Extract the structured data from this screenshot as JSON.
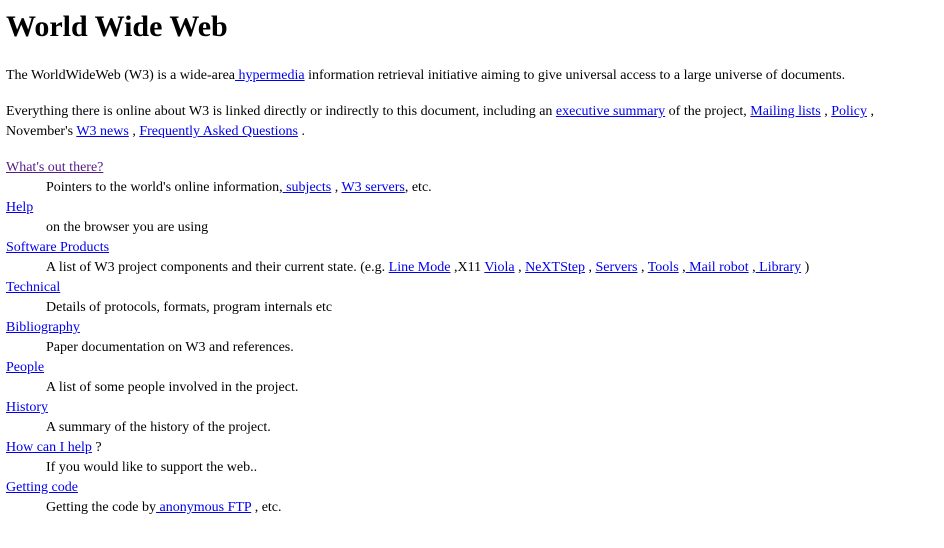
{
  "page_title": "World Wide Web",
  "intro": {
    "before": "The WorldWideWeb (W3) is a wide-area",
    "link_hypermedia": " hypermedia",
    "after": " information retrieval initiative aiming to give universal access to a large universe of documents."
  },
  "everything": {
    "t1": "Everything there is online about W3 is linked directly or indirectly to this document, including an ",
    "link_exec": "executive summary",
    "t2": " of the project, ",
    "link_mailing": "Mailing lists",
    "t3": " , ",
    "link_policy": "Policy",
    "t4": " , November's ",
    "link_news": "W3 news",
    "t5": " , ",
    "link_faq": "Frequently Asked Questions",
    "t6": " ."
  },
  "sections": {
    "whats_out": {
      "link": "What's out there?",
      "d1": "Pointers to the world's online information,",
      "link_subjects": " subjects",
      "d2": " , ",
      "link_servers": "W3 servers",
      "d3": ", etc."
    },
    "help": {
      "link": "Help",
      "desc": "on the browser you are using"
    },
    "software": {
      "link": "Software Products",
      "d1": "A list of W3 project components and their current state. (e.g. ",
      "link_linemode": "Line Mode",
      "d2": " ,X11 ",
      "link_viola": "Viola",
      "d3": " , ",
      "link_nextstep": "NeXTStep",
      "d4": " , ",
      "link_servers": "Servers",
      "d5": " , ",
      "link_tools": "Tools",
      "d6": " ,",
      "link_mailrobot": " Mail robot",
      "d7": " ,",
      "link_library": " Library",
      "d8": " )"
    },
    "technical": {
      "link": "Technical",
      "desc": "Details of protocols, formats, program internals etc"
    },
    "bibliography": {
      "link": "Bibliography",
      "desc": "Paper documentation on W3 and references."
    },
    "people": {
      "link": "People",
      "desc": "A list of some people involved in the project."
    },
    "history": {
      "link": "History",
      "desc": "A summary of the history of the project."
    },
    "how_help": {
      "link": "How can I help",
      "after": " ?",
      "desc": "If you would like to support the web.."
    },
    "getting_code": {
      "link": "Getting code",
      "d1": "Getting the code by",
      "link_ftp": " anonymous FTP",
      "d2": " , etc."
    }
  },
  "colors": {
    "link": "#0000ee",
    "visited_link": "#551a8b",
    "text": "#000000",
    "background": "#ffffff"
  }
}
